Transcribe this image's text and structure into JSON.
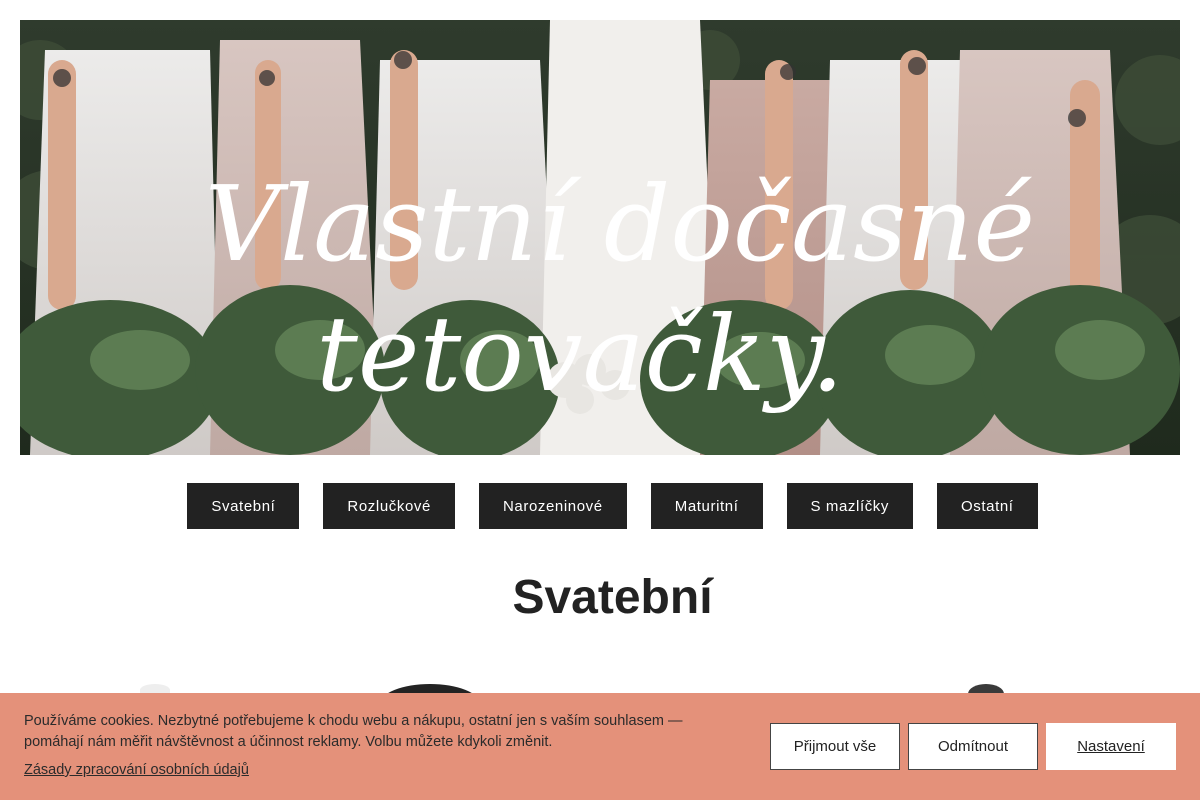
{
  "hero": {
    "headline_line1": "Vlastní dočasné",
    "headline_line2": "tetovačky."
  },
  "categories": [
    {
      "label": "Svatební"
    },
    {
      "label": "Rozlučkové"
    },
    {
      "label": "Narozeninové"
    },
    {
      "label": "Maturitní"
    },
    {
      "label": "S mazlíčky"
    },
    {
      "label": "Ostatní"
    }
  ],
  "section": {
    "title": "Svatební"
  },
  "cookie": {
    "message": "Používáme cookies. Nezbytné potřebujeme k chodu webu a nákupu, ostatní jen s vaším souhlasem — pomáhají nám měřit návštěvnost a účinnost reklamy. Volbu můžete kdykoli změnit.",
    "policy_link": "Zásady zpracování osobních údajů",
    "accept_label": "Přijmout vše",
    "reject_label": "Odmítnout",
    "settings_label": "Nastavení"
  },
  "colors": {
    "cookie_bg": "#e4917a",
    "nav_bg": "#222222",
    "nav_text": "#ffffff"
  }
}
